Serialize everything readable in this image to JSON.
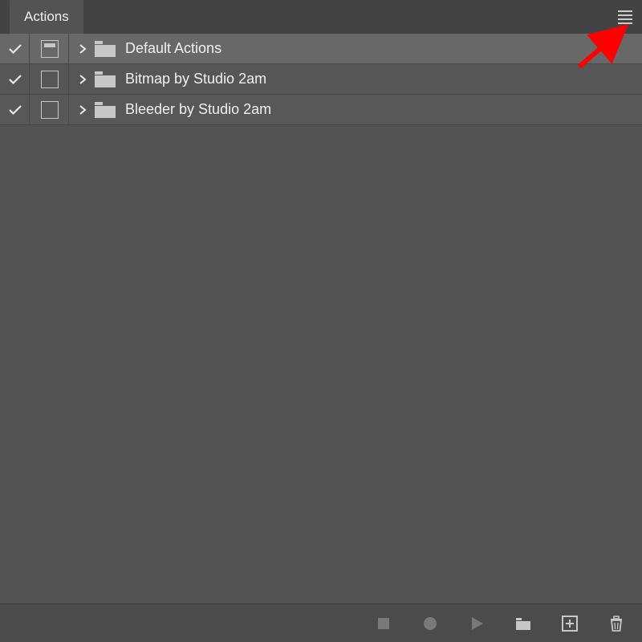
{
  "header": {
    "tab_label": "Actions"
  },
  "actions": [
    {
      "label": "Default Actions",
      "checked": true,
      "mode_filled": true,
      "selected": true
    },
    {
      "label": "Bitmap by Studio 2am",
      "checked": true,
      "mode_filled": false,
      "selected": false
    },
    {
      "label": "Bleeder by Studio 2am",
      "checked": true,
      "mode_filled": false,
      "selected": false
    }
  ],
  "footer": {
    "stop": "Stop",
    "record": "Record",
    "play": "Play",
    "folder": "New Set",
    "new": "New Action",
    "delete": "Delete"
  }
}
